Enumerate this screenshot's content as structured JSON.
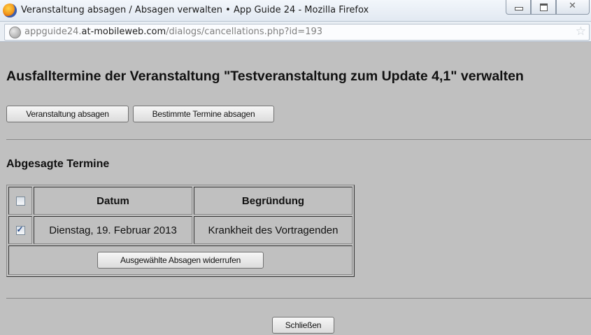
{
  "window": {
    "title": "Veranstaltung absagen / Absagen verwalten • App Guide 24 - Mozilla Firefox",
    "controls": [
      "minimize-icon",
      "maximize-icon",
      "close-icon"
    ],
    "close_glyph": "✕"
  },
  "address_bar": {
    "url_prefix": "appguide24.",
    "url_domain": "at-mobileweb.com",
    "url_path": "/dialogs/cancellations.php?id=193",
    "icon": "globe-icon",
    "bookmark_glyph": "☆"
  },
  "page": {
    "title": "Ausfalltermine der Veranstaltung \"Testveranstaltung zum Update 4,1\" verwalten",
    "buttons": {
      "cancel_event": "Veranstaltung absagen",
      "cancel_dates": "Bestimmte Termine absagen"
    },
    "section_title": "Abgesagte Termine",
    "table": {
      "header_checked": false,
      "columns": [
        "Datum",
        "Begründung"
      ],
      "rows": [
        {
          "checked": true,
          "date": "Dienstag, 19. Februar 2013",
          "reason": "Krankheit des Vortragenden"
        }
      ],
      "revoke_label": "Ausgewählte Absagen widerrufen"
    },
    "close_label": "Schließen"
  }
}
